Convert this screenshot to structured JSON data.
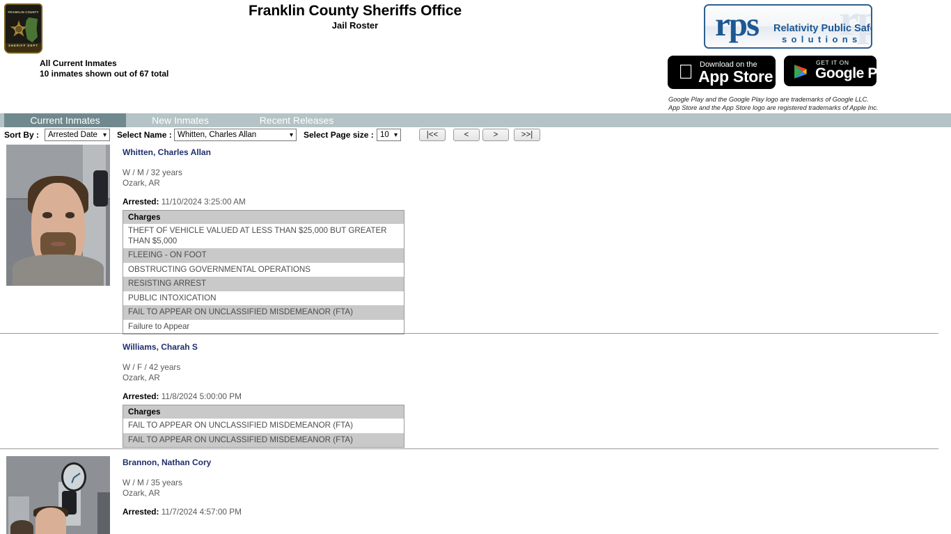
{
  "header": {
    "title": "Franklin County Sheriffs Office",
    "subtitle": "Jail Roster",
    "badge": {
      "icon": "sheriff-badge-icon",
      "top_text": "FRANKLIN COUNTY",
      "bottom_text": "SHERIFF  DEPT"
    },
    "summary_line1": "All Current Inmates",
    "summary_line2": "10 inmates shown out of 67 total",
    "brand": {
      "logo_mark": "rps",
      "logo_line1": "Relativity Public Safety",
      "logo_line2": "solutions",
      "watermark": "rps",
      "accent_color": "#1d5893",
      "border_color": "#2d5f8f"
    },
    "app_store": {
      "icon": "apple-logo-icon",
      "small_text": "Download on the",
      "big_text": "App Store"
    },
    "google_play": {
      "icon": "google-play-icon",
      "small_text": "GET IT ON",
      "big_text": "Google Play"
    },
    "trademark_line1": "Google Play and the Google Play logo are trademarks of Google LLC.",
    "trademark_line2": "App Store and the App Store logo are registered trademarks of Apple Inc."
  },
  "tabs": {
    "active_color": "#70898e",
    "bar_color": "#b4c3c6",
    "items": [
      {
        "label": "Current Inmates",
        "active": true
      },
      {
        "label": "New Inmates",
        "active": false
      },
      {
        "label": "Recent Releases",
        "active": false
      }
    ]
  },
  "controls": {
    "sort_by_label": "Sort By :",
    "sort_by_value": "Arrested Date",
    "sort_by_options": [
      "Arrested Date"
    ],
    "select_name_label": "Select Name :",
    "select_name_value": "Whitten, Charles Allan",
    "select_name_options": [
      "Whitten, Charles Allan"
    ],
    "page_size_label": "Select Page size :",
    "page_size_value": "10",
    "page_size_options": [
      "10"
    ],
    "pagination": [
      {
        "label": "|<<",
        "name": "first-page-button"
      },
      {
        "label": "<",
        "name": "previous-page-button"
      },
      {
        "label": ">",
        "name": "next-page-button"
      },
      {
        "label": ">>|",
        "name": "last-page-button"
      }
    ]
  },
  "roster": {
    "charges_column_header": "Charges",
    "arrested_label": "Arrested:",
    "records": [
      {
        "name": "Whitten, Charles Allan",
        "demographics": "W / M / 32 years",
        "location": "Ozark, AR",
        "arrested": "11/10/2024 3:25:00 AM",
        "mugshot": "inmate-mugshot-whitten",
        "charges": [
          "THEFT OF VEHICLE VALUED AT LESS THAN $25,000 BUT GREATER THAN $5,000",
          "FLEEING - ON FOOT",
          "OBSTRUCTING GOVERNMENTAL OPERATIONS",
          "RESISTING ARREST",
          "PUBLIC INTOXICATION",
          "FAIL TO APPEAR ON UNCLASSIFIED MISDEMEANOR (FTA)",
          "Failure to Appear"
        ]
      },
      {
        "name": "Williams, Charah S",
        "demographics": "W / F / 42 years",
        "location": "Ozark, AR",
        "arrested": "11/8/2024 5:00:00 PM",
        "mugshot": null,
        "charges": [
          "FAIL TO APPEAR ON UNCLASSIFIED MISDEMEANOR (FTA)",
          "FAIL TO APPEAR ON UNCLASSIFIED MISDEMEANOR (FTA)"
        ]
      },
      {
        "name": "Brannon, Nathan Cory",
        "demographics": "W / M / 35 years",
        "location": "Ozark, AR",
        "arrested": "11/7/2024 4:57:00 PM",
        "mugshot": "inmate-mugshot-brannon",
        "charges": []
      }
    ]
  }
}
